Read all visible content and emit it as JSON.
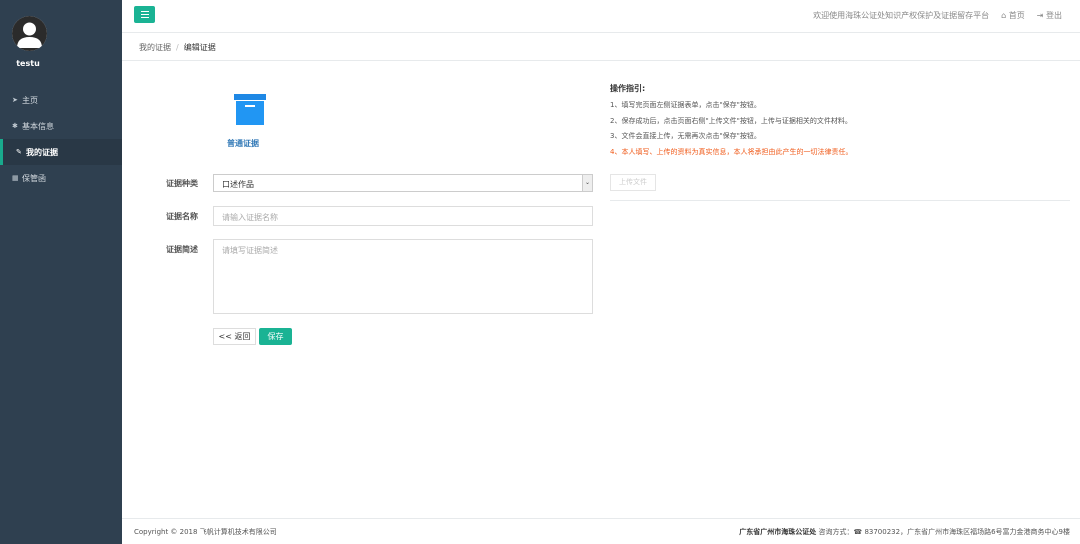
{
  "sidebar": {
    "username": "testu",
    "items": [
      {
        "icon": "home-icon",
        "glyph": "➤",
        "label": "主页"
      },
      {
        "icon": "gear-icon",
        "glyph": "✱",
        "label": "基本信息"
      },
      {
        "icon": "gavel-icon",
        "glyph": "✎",
        "label": "我的证据"
      },
      {
        "icon": "box-icon",
        "glyph": "▦",
        "label": "保管函"
      }
    ],
    "active_index": 2
  },
  "topbar": {
    "welcome": "欢迎使用海珠公证处知识产权保护及证据留存平台",
    "home": "首页",
    "logout": "登出"
  },
  "breadcrumb": {
    "parent": "我的证据",
    "current": "编辑证据"
  },
  "form": {
    "type_label": "普通证据",
    "evidence_type": {
      "label": "证据种类",
      "value": "口述作品"
    },
    "evidence_name": {
      "label": "证据名称",
      "placeholder": "请输入证据名称"
    },
    "evidence_desc": {
      "label": "证据简述",
      "placeholder": "请填写证据简述"
    },
    "back_button": "<< 返回",
    "save_button": "保存"
  },
  "guide": {
    "title": "操作指引:",
    "steps": [
      "1、填写完页面左侧证据表单，点击\"保存\"按钮。",
      "2、保存成功后，点击页面右侧\"上传文件\"按钮，上传与证据相关的文件材料。",
      "3、文件会直接上传，无需再次点击\"保存\"按钮。"
    ],
    "warning": "4、本人填写、上传的资料为真实信息，本人将承担由此产生的一切法律责任。",
    "upload_button": "上传文件"
  },
  "footer": {
    "copyright": "Copyright © 2018 飞帆计算机技术有限公司",
    "office": "广东省广州市海珠公证处",
    "contact_label": "咨询方式：",
    "phone": "83700232",
    "address": "广东省广州市海珠区福场路6号富力金港商务中心9楼"
  },
  "colors": {
    "sidebar_bg": "#2f4050",
    "accent": "#1ab394",
    "warning": "#f05a19",
    "link": "#337ab7"
  }
}
